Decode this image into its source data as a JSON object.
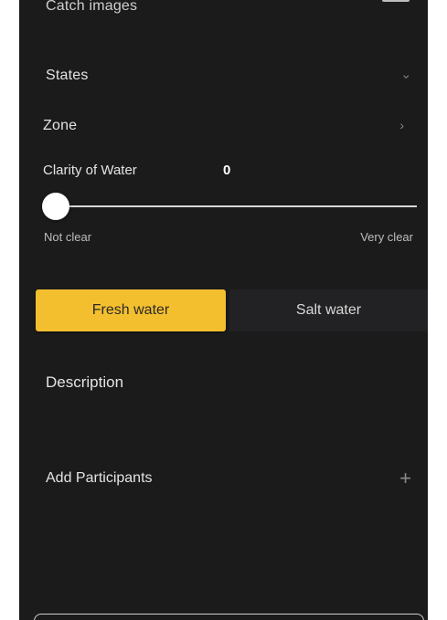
{
  "form": {
    "catch_images_label": "Catch images",
    "states_label": "States",
    "zone_label": "Zone",
    "clarity": {
      "label": "Clarity of Water",
      "value": "0",
      "min_label": "Not clear",
      "max_label": "Very clear",
      "level_fraction": 0
    },
    "water_type": {
      "options": [
        "Fresh water",
        "Salt water"
      ],
      "selected": "Fresh water"
    },
    "description_label": "Description",
    "participants_label": "Add Participants",
    "icons": {
      "catch_images": "image-icon",
      "states": "chevron-down-icon",
      "zone": "chevron-right-icon",
      "participants": "plus-icon"
    }
  },
  "colors": {
    "background": "#1b1b1c",
    "accent": "#f4bf2e",
    "text": "#e4e4e4"
  }
}
